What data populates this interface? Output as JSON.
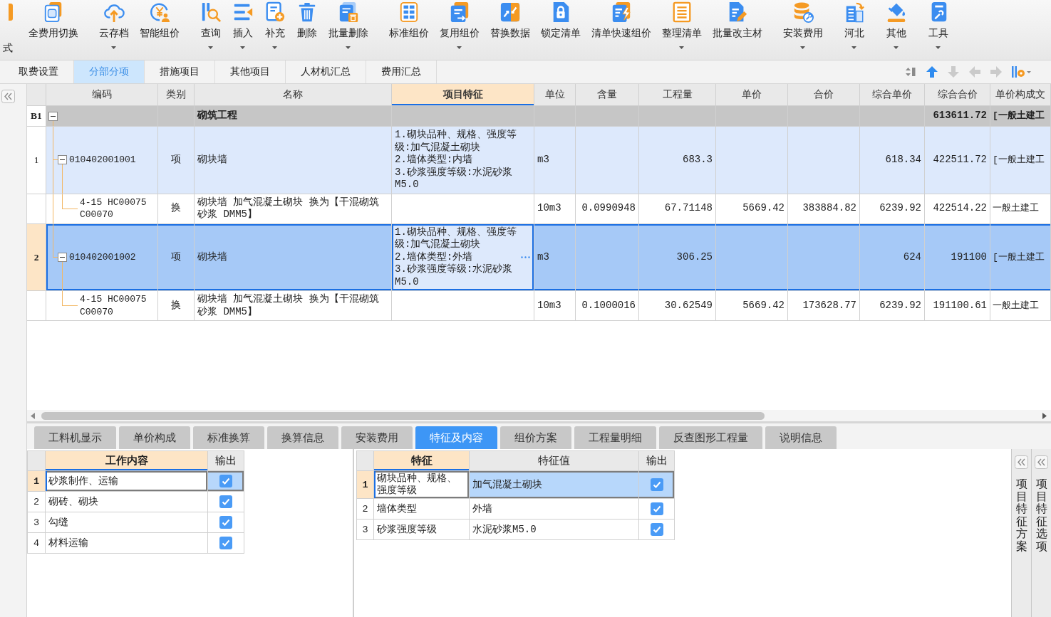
{
  "toolbar": {
    "clipped_label": "式",
    "groups": [
      {
        "items": [
          {
            "label": "全费用切换",
            "has_menu": false
          }
        ]
      },
      {
        "items": [
          {
            "label": "云存档",
            "has_menu": true
          },
          {
            "label": "智能组价",
            "has_menu": false
          }
        ]
      },
      {
        "items": [
          {
            "label": "查询",
            "has_menu": true
          },
          {
            "label": "插入",
            "has_menu": true
          },
          {
            "label": "补充",
            "has_menu": true
          },
          {
            "label": "删除",
            "has_menu": false
          },
          {
            "label": "批量删除",
            "has_menu": true
          }
        ]
      },
      {
        "items": [
          {
            "label": "标准组价",
            "has_menu": false
          },
          {
            "label": "复用组价",
            "has_menu": true
          },
          {
            "label": "替换数据",
            "has_menu": false
          },
          {
            "label": "锁定清单",
            "has_menu": false
          },
          {
            "label": "清单快速组价",
            "has_menu": false
          },
          {
            "label": "整理清单",
            "has_menu": true
          },
          {
            "label": "批量改主材",
            "has_menu": false
          }
        ]
      },
      {
        "items": [
          {
            "label": "安装费用",
            "has_menu": true
          }
        ]
      },
      {
        "items": [
          {
            "label": "河北",
            "has_menu": true
          }
        ]
      },
      {
        "items": [
          {
            "label": "其他",
            "has_menu": true
          }
        ]
      },
      {
        "items": [
          {
            "label": "工具",
            "has_menu": true
          }
        ]
      }
    ]
  },
  "tabs": [
    {
      "label": "取费设置",
      "selected": false
    },
    {
      "label": "分部分项",
      "selected": true
    },
    {
      "label": "措施项目",
      "selected": false
    },
    {
      "label": "其他项目",
      "selected": false
    },
    {
      "label": "人材机汇总",
      "selected": false
    },
    {
      "label": "费用汇总",
      "selected": false
    }
  ],
  "move_buttons": [
    {
      "disabled": false
    },
    {
      "disabled": true
    },
    {
      "disabled": true
    },
    {
      "disabled": true
    }
  ],
  "grid": {
    "columns": [
      {
        "label": "编码",
        "selected": false
      },
      {
        "label": "类别",
        "selected": false
      },
      {
        "label": "名称",
        "selected": false
      },
      {
        "label": "项目特征",
        "selected": true
      },
      {
        "label": "单位",
        "selected": false
      },
      {
        "label": "含量",
        "selected": false
      },
      {
        "label": "工程量",
        "selected": false
      },
      {
        "label": "单价",
        "selected": false
      },
      {
        "label": "合价",
        "selected": false
      },
      {
        "label": "综合单价",
        "selected": false
      },
      {
        "label": "综合合价",
        "selected": false
      },
      {
        "label": "单价构成文",
        "selected": false
      }
    ],
    "rows": [
      {
        "row_label": "B1",
        "name": "砌筑工程",
        "total_price": "613611.72",
        "composition": "[一般土建工",
        "expanded": true,
        "selected": false,
        "children": [
          {
            "row_label": "1",
            "code": "010402001001",
            "type": "项",
            "name": "砌块墙",
            "features": "1.砌块品种、规格、强度等级:加气混凝土砌块\n2.墙体类型:内墙\n3.砂浆强度等级:水泥砂浆M5.0",
            "unit": "m3",
            "quantity": "683.3",
            "unit_total_price": "618.34",
            "total_price": "422511.72",
            "composition": "[一般土建工",
            "expanded": true,
            "selected": false,
            "children": [
              {
                "code": "4-15 HC00075 C00070",
                "type": "换",
                "name": "砌块墙 加气混凝土砌块 换为【干混砌筑砂浆 DMM5】",
                "unit": "10m3",
                "content": "0.0990948",
                "quantity": "67.71148",
                "unit_price": "5669.42",
                "price": "383884.82",
                "unit_total_price": "6239.92",
                "total_price": "422514.22",
                "composition": "一般土建工",
                "selected": false
              }
            ]
          },
          {
            "row_label": "2",
            "code": "010402001002",
            "type": "项",
            "name": "砌块墙",
            "features": "1.砌块品种、规格、强度等级:加气混凝土砌块\n2.墙体类型:外墙\n3.砂浆强度等级:水泥砂浆M5.0",
            "unit": "m3",
            "quantity": "306.25",
            "unit_total_price": "624",
            "total_price": "191100",
            "composition": "[一般土建工",
            "expanded": true,
            "selected": true,
            "children": [
              {
                "code": "4-15 HC00075 C00070",
                "type": "换",
                "name": "砌块墙 加气混凝土砌块 换为【干混砌筑砂浆 DMM5】",
                "unit": "10m3",
                "content": "0.1000016",
                "quantity": "30.62549",
                "unit_price": "5669.42",
                "price": "173628.77",
                "unit_total_price": "6239.92",
                "total_price": "191100.61",
                "composition": "一般土建工",
                "selected": false
              }
            ]
          }
        ]
      }
    ]
  },
  "detail_tabs": [
    {
      "label": "工料机显示",
      "selected": false
    },
    {
      "label": "单价构成",
      "selected": false
    },
    {
      "label": "标准换算",
      "selected": false
    },
    {
      "label": "换算信息",
      "selected": false
    },
    {
      "label": "安装费用",
      "selected": false
    },
    {
      "label": "特征及内容",
      "selected": true
    },
    {
      "label": "组价方案",
      "selected": false
    },
    {
      "label": "工程量明细",
      "selected": false
    },
    {
      "label": "反查图形工程量",
      "selected": false
    },
    {
      "label": "说明信息",
      "selected": false
    }
  ],
  "work_content": {
    "columns": [
      {
        "label": "工作内容",
        "selected": true
      },
      {
        "label": "输出",
        "selected": false
      }
    ],
    "rows": [
      {
        "row_label": "1",
        "text": "砂浆制作、运输",
        "output": true,
        "selected": true
      },
      {
        "row_label": "2",
        "text": "砌砖、砌块",
        "output": true,
        "selected": false
      },
      {
        "row_label": "3",
        "text": "勾缝",
        "output": true,
        "selected": false
      },
      {
        "row_label": "4",
        "text": "材料运输",
        "output": true,
        "selected": false
      }
    ]
  },
  "features": {
    "columns": [
      {
        "label": "特征",
        "selected": true
      },
      {
        "label": "特征值",
        "selected": false
      },
      {
        "label": "输出",
        "selected": false
      }
    ],
    "rows": [
      {
        "row_label": "1",
        "name": "砌块品种、规格、强度等级",
        "value": "加气混凝土砌块",
        "output": true,
        "selected": true
      },
      {
        "row_label": "2",
        "name": "墙体类型",
        "value": "外墙",
        "output": true,
        "selected": false
      },
      {
        "row_label": "3",
        "name": "砂浆强度等级",
        "value": "水泥砂浆M5.0",
        "output": true,
        "selected": false
      }
    ]
  },
  "side_panels": [
    "项目特征方案",
    "项目特征选项"
  ]
}
